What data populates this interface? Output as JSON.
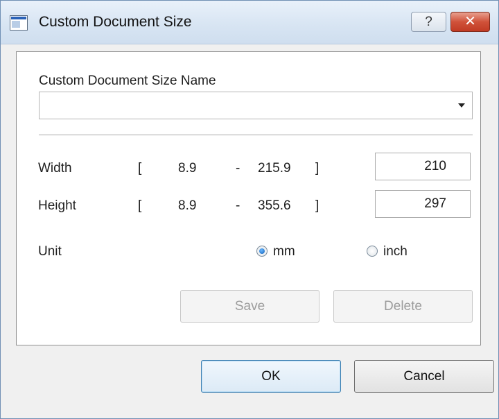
{
  "window": {
    "title": "Custom Document Size",
    "help_label": "?",
    "close_label": "✕"
  },
  "form": {
    "name_label": "Custom Document Size Name",
    "name_value": "",
    "width": {
      "label": "Width",
      "bracket_open": "[",
      "min": "8.9",
      "dash": "-",
      "max": "215.9",
      "bracket_close": "]",
      "value": "210"
    },
    "height": {
      "label": "Height",
      "bracket_open": "[",
      "min": "8.9",
      "dash": "-",
      "max": "355.6",
      "bracket_close": "]",
      "value": "297"
    },
    "unit": {
      "label": "Unit",
      "options": [
        "mm",
        "inch"
      ],
      "selected": "mm"
    },
    "save_label": "Save",
    "delete_label": "Delete"
  },
  "footer": {
    "ok_label": "OK",
    "cancel_label": "Cancel"
  }
}
